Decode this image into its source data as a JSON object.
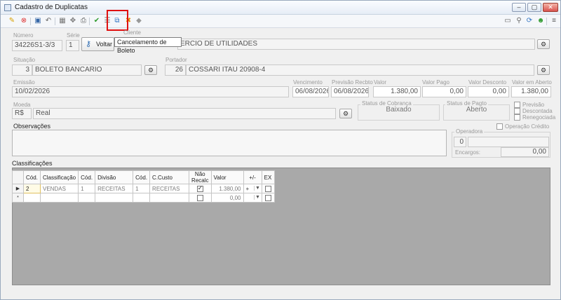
{
  "window": {
    "title": "Cadastro de Duplicatas"
  },
  "tooltip": "Cancelamento de Boleto",
  "voltar_label": "Voltar",
  "header": {
    "numero_label": "Número",
    "numero": "34226S1-3/3",
    "serie_label": "Série",
    "serie": "1",
    "cliente_label": "Cliente",
    "cliente": "ERCIO DE UTILIDADES"
  },
  "situacao": {
    "label": "Situação",
    "code": "3",
    "text": "BOLETO BANCARIO"
  },
  "portador": {
    "label": "Portador",
    "code": "26",
    "text": "COSSARI ITAU 20908-4"
  },
  "emissao": {
    "label": "Emissão",
    "value": "10/02/2026"
  },
  "vencimento": {
    "label": "Vencimento",
    "value": "06/08/2026"
  },
  "previsao": {
    "label": "Previsão Recbto",
    "value": "06/08/2026"
  },
  "valor": {
    "label": "Valor",
    "value": "1.380,00"
  },
  "valor_pago": {
    "label": "Valor Pago",
    "value": "0,00"
  },
  "valor_desconto": {
    "label": "Valor Desconto",
    "value": "0,00"
  },
  "valor_aberto": {
    "label": "Valor em Aberto",
    "value": "1.380,00"
  },
  "moeda": {
    "label": "Moeda",
    "symbol": "R$",
    "text": "Real"
  },
  "status_cobranca": {
    "label": "Status de Cobrança",
    "value": "Baixado"
  },
  "status_pagto": {
    "label": "Status de Pagto",
    "value": "Aberto"
  },
  "flags": {
    "previsao": "Previsão",
    "descontada": "Descontada",
    "renegociada": "Renegociada",
    "operacao_credito": "Operação Crédito"
  },
  "observacoes_label": "Observações",
  "operadora": {
    "label": "Operadora",
    "value": "0",
    "encargos_label": "Encargos:",
    "encargos": "0,00"
  },
  "classificacoes": {
    "label": "Classificações",
    "columns": [
      "Cód.",
      "Classificação",
      "Cód.",
      "Divisão",
      "Cód.",
      "C.Custo",
      "Não Recalc",
      "Valor",
      "+/-",
      "EX"
    ],
    "rows": [
      {
        "indicator": "▶",
        "cod1": "2",
        "classificacao": "VENDAS",
        "cod2": "1",
        "divisao": "RECEITAS",
        "cod3": "1",
        "ccusto": "RECEITAS",
        "nao_recalc": true,
        "valor": "1.380,00",
        "sign": "+",
        "ex": false
      },
      {
        "indicator": "*",
        "cod1": "",
        "classificacao": "",
        "cod2": "",
        "divisao": "",
        "cod3": "",
        "ccusto": "",
        "nao_recalc": false,
        "valor": "0,00",
        "sign": "",
        "ex": false
      }
    ]
  }
}
